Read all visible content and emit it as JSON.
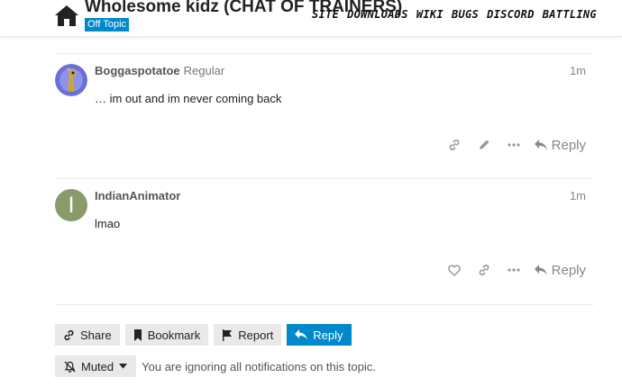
{
  "header": {
    "title": "Wholesome kidz (CHAT OF TRAINERS)",
    "category": "Off Topic",
    "nav": [
      "SITE",
      "DOWNLOADS",
      "WIKI",
      "BUGS",
      "DISCORD",
      "BATTLING"
    ]
  },
  "posts": [
    {
      "username": "Boggaspotatoe",
      "user_title": "Regular",
      "date": "1m",
      "body": "… im out and im never coming back",
      "actions": [
        "link-icon",
        "edit-icon",
        "more-icon"
      ],
      "reply_label": "Reply"
    },
    {
      "username": "IndianAnimator",
      "user_title": "",
      "avatar_letter": "I",
      "avatar_color": "#8a9a6a",
      "date": "1m",
      "body": "lmao",
      "actions": [
        "like-icon",
        "link-icon",
        "more-icon"
      ],
      "reply_label": "Reply"
    }
  ],
  "footer": {
    "share": "Share",
    "bookmark": "Bookmark",
    "report": "Report",
    "reply": "Reply",
    "muted": "Muted",
    "notification_text": "You are ignoring all notifications on this topic."
  },
  "colors": {
    "accent": "#0088cc",
    "button_bg": "#e9e9e9"
  }
}
